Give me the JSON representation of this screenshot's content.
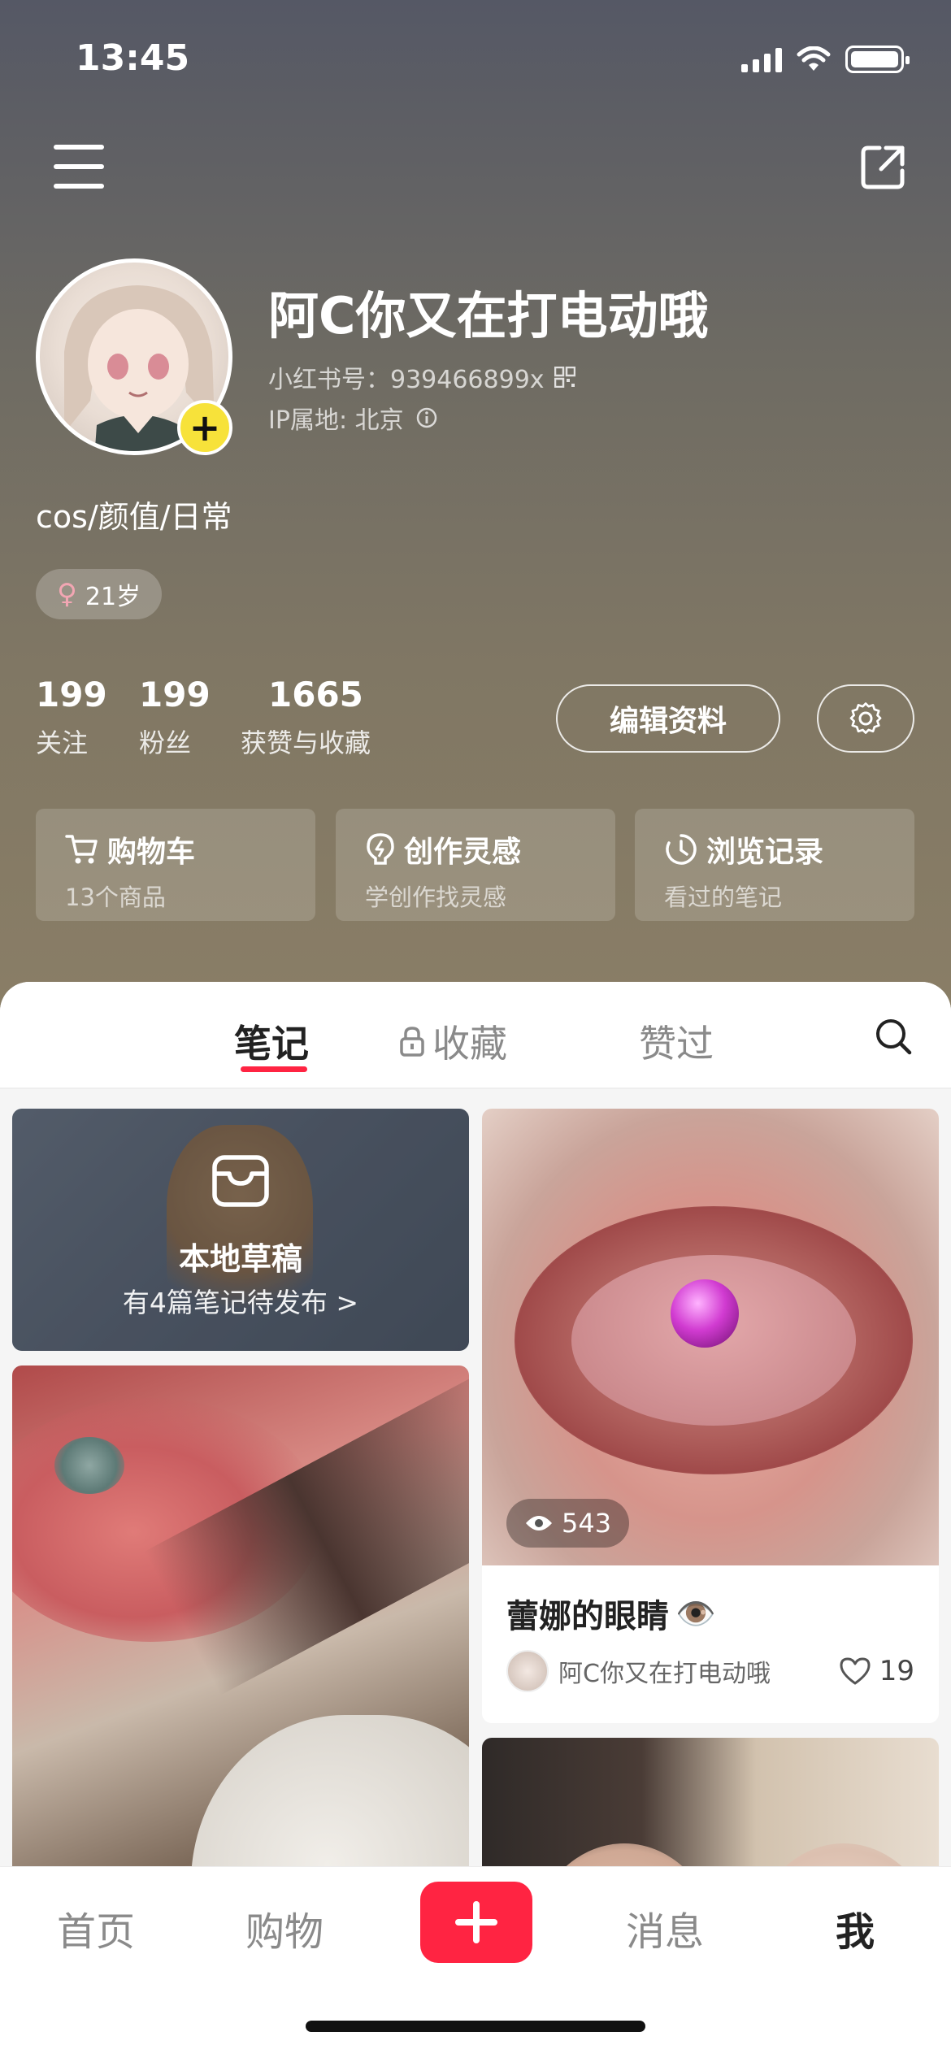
{
  "status_bar": {
    "time": "13:45"
  },
  "profile": {
    "nickname": "阿C你又在打电动哦",
    "redid": "小红书号：939466899x",
    "ip": "IP属地: 北京",
    "bio": "cos/颜值/日常",
    "age": "21岁"
  },
  "stats": [
    {
      "num": "199",
      "label": "关注"
    },
    {
      "num": "199",
      "label": "粉丝"
    },
    {
      "num": "1665",
      "label": "获赞与收藏"
    }
  ],
  "actions": {
    "edit_profile": "编辑资料"
  },
  "cards": [
    {
      "title": "购物车",
      "sub": "13个商品",
      "icon": "cart-icon"
    },
    {
      "title": "创作灵感",
      "sub": "学创作找灵感",
      "icon": "bulb-icon"
    },
    {
      "title": "浏览记录",
      "sub": "看过的笔记",
      "icon": "clock-icon"
    }
  ],
  "tabs": {
    "notes": "笔记",
    "collect": "收藏",
    "liked": "赞过",
    "active": "笔记"
  },
  "draft": {
    "title": "本地草稿",
    "sub": "有4篇笔记待发布 >"
  },
  "note": {
    "views": "543",
    "title": "蕾娜的眼睛",
    "title_emoji": "👁️",
    "author": "阿C你又在打电动哦",
    "likes": "19"
  },
  "bottom_nav": {
    "home": "首页",
    "shop": "购物",
    "messages": "消息",
    "me": "我",
    "active": "我"
  },
  "colors": {
    "accent": "#ff2442",
    "badge": "#f7e23a"
  }
}
